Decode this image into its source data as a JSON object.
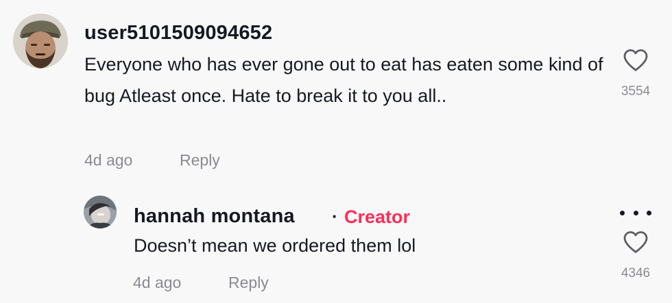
{
  "comment": {
    "username": "user5101509094652",
    "text": "Everyone who has ever gone out to eat has eaten some kind of bug Atleast once. Hate to break it to you all..",
    "time": "4d ago",
    "reply_label": "Reply",
    "like_count": "3554",
    "like_icon": "heart-outline-icon"
  },
  "reply": {
    "username": "hannah montana",
    "separator": "·",
    "badge": "Creator",
    "badge_color": "#fe2c55",
    "text": "Doesn’t mean we ordered them lol",
    "time": "4d ago",
    "reply_label": "Reply",
    "like_count": "4346",
    "like_icon": "heart-outline-icon",
    "more_icon": "more-horizontal-icon"
  },
  "colors": {
    "background": "#f8f8f8",
    "text_primary": "#161823",
    "text_secondary": "#8a8b91",
    "accent": "#fe2c55"
  }
}
